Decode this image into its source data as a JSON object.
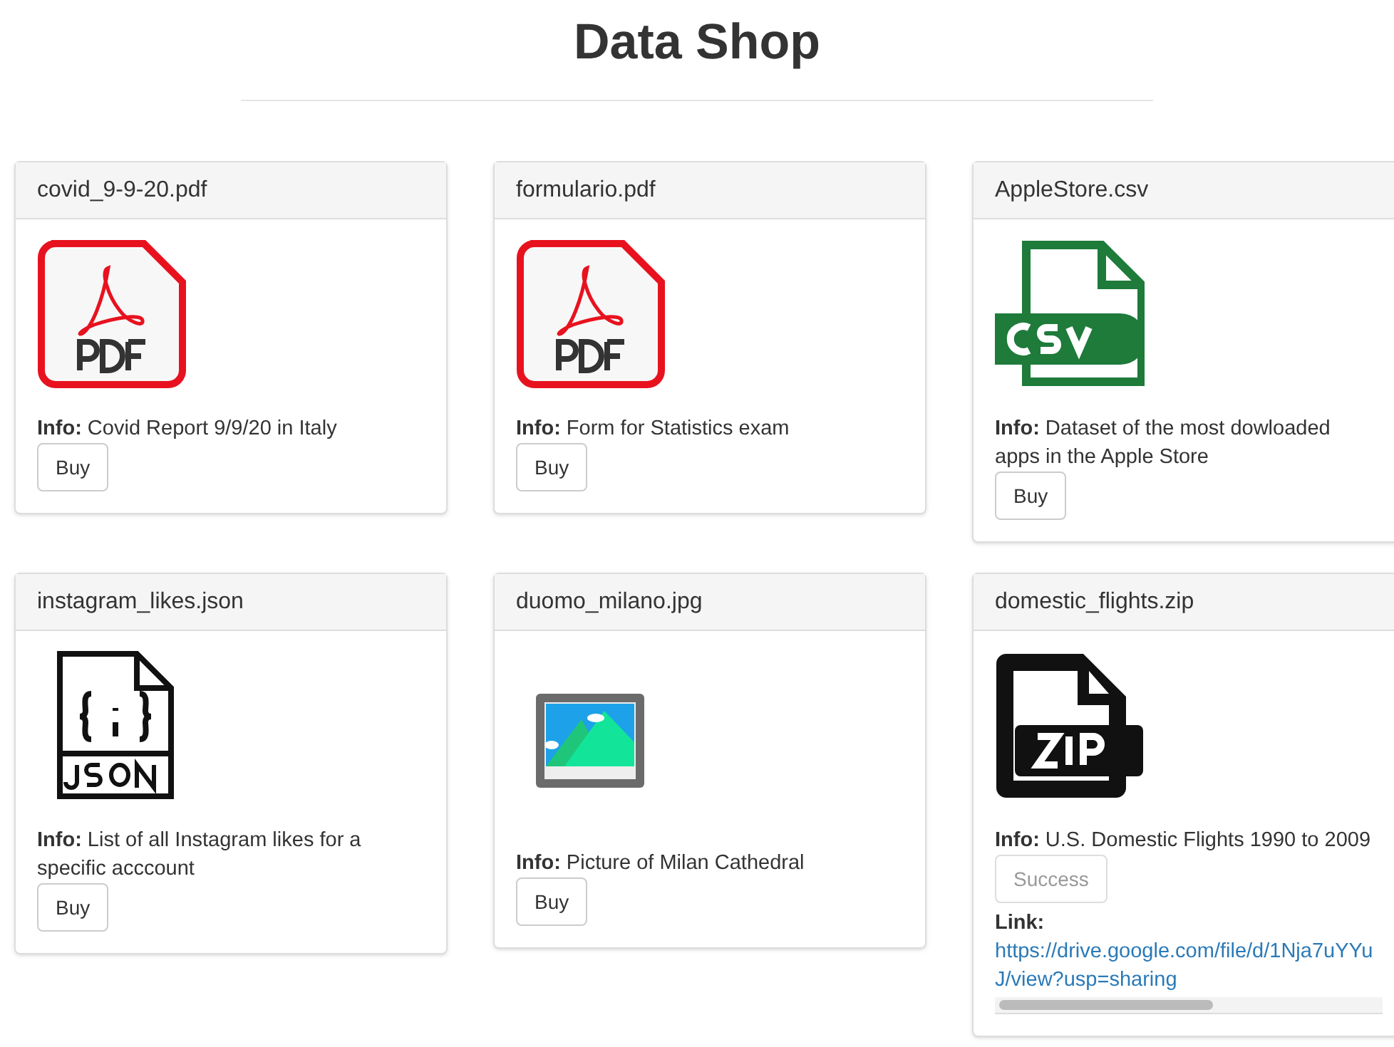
{
  "title": "Data Shop",
  "files": [
    {
      "name": "covid_9-9-20.pdf",
      "kind": "pdf",
      "info_label": "Info:",
      "info": "Covid Report 9/9/20 in Italy",
      "button": {
        "label": "Buy",
        "disabled": false
      }
    },
    {
      "name": "formulario.pdf",
      "kind": "pdf",
      "info_label": "Info:",
      "info": "Form for Statistics exam",
      "button": {
        "label": "Buy",
        "disabled": false
      }
    },
    {
      "name": "AppleStore.csv",
      "kind": "csv",
      "info_label": "Info:",
      "info": "Dataset of the most dowloaded apps in the Apple Store",
      "button": {
        "label": "Buy",
        "disabled": false
      }
    },
    {
      "name": "instagram_likes.json",
      "kind": "json",
      "info_label": "Info:",
      "info": "List of all Instagram likes for a specific acccount",
      "button": {
        "label": "Buy",
        "disabled": false
      }
    },
    {
      "name": "duomo_milano.jpg",
      "kind": "image",
      "info_label": "Info:",
      "info": "Picture of Milan Cathedral",
      "button": {
        "label": "Buy",
        "disabled": false
      }
    },
    {
      "name": "domestic_flights.zip",
      "kind": "zip",
      "info_label": "Info:",
      "info": "U.S. Domestic Flights 1990 to 2009",
      "button": {
        "label": "Success",
        "disabled": true
      },
      "link_label": "Link:",
      "link_lines": [
        "https://drive.google.com/file/d/1Nja7uYYu",
        "J/view?usp=sharing"
      ]
    }
  ]
}
